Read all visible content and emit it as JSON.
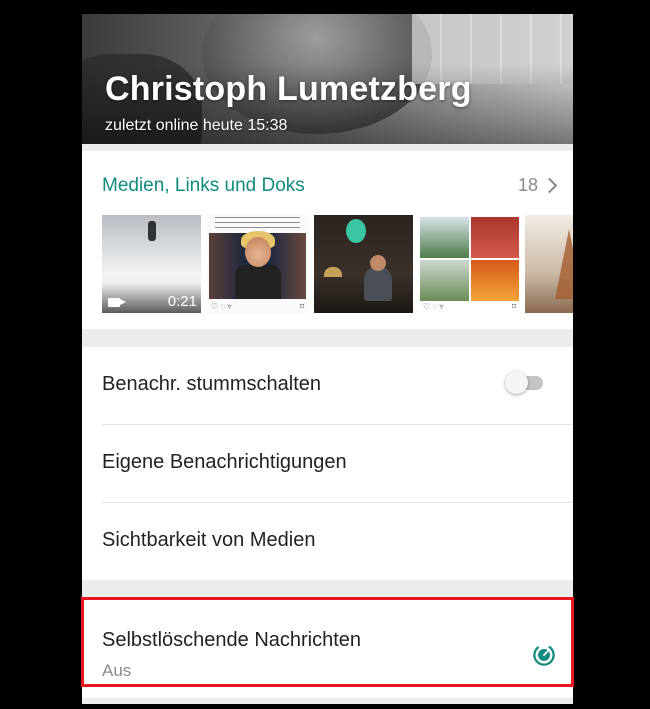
{
  "header": {
    "contact_name": "Christoph Lumetzberg",
    "last_seen": "zuletzt online heute 15:38"
  },
  "media": {
    "title": "Medien, Links und Doks",
    "count": "18",
    "chevron_icon": "chevron-right-icon",
    "video_duration": "0:21",
    "video_icon": "video-camera-icon",
    "thumb_icons_left": "♡ ◌ ▿",
    "thumb_icons_right": "⌑"
  },
  "settings": {
    "mute_label": "Benachr. stummschalten",
    "mute_enabled": false,
    "custom_notifications_label": "Eigene Benachrichtigungen",
    "media_visibility_label": "Sichtbarkeit von Medien"
  },
  "disappearing": {
    "title": "Selbstlöschende Nachrichten",
    "status": "Aus",
    "icon": "disappearing-timer-icon"
  },
  "colors": {
    "accent": "#128c7e",
    "highlight": "#e8161e",
    "toggle_off": "#c4c4c4"
  }
}
